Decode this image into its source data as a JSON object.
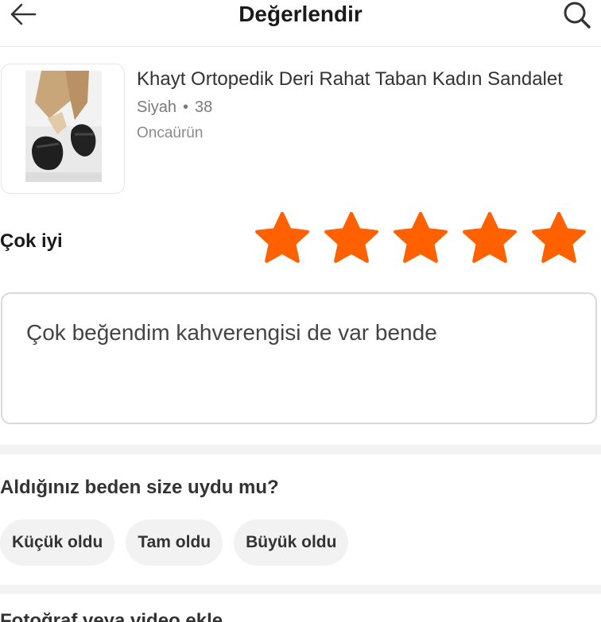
{
  "header": {
    "title": "Değerlendir"
  },
  "product": {
    "name": "Khayt Ortopedik Deri Rahat Taban Kadın Sandalet",
    "color": "Siyah",
    "separator": "•",
    "size": "38",
    "seller": "Oncaürün"
  },
  "rating": {
    "label": "Çok iyi",
    "value": 5,
    "max": 5,
    "color": "#ff6000"
  },
  "review": {
    "text": "Çok beğendim kahverengisi de var bende"
  },
  "size_fit": {
    "question": "Aldığınız beden size uydu mu?",
    "options": [
      "Küçük oldu",
      "Tam oldu",
      "Büyük oldu"
    ]
  },
  "next_section": {
    "heading": "Fotoğraf veya video ekle"
  }
}
